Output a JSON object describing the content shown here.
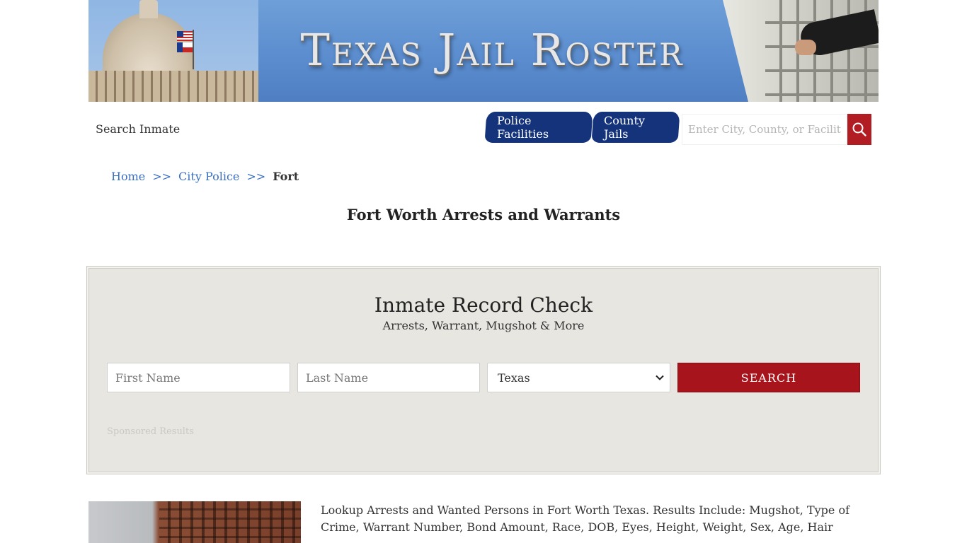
{
  "banner": {
    "title": "Texas Jail Roster"
  },
  "nav": {
    "search_inmate": "Search Inmate",
    "tabs": [
      {
        "label": "Police Facilities"
      },
      {
        "label": "County Jails"
      }
    ],
    "search_placeholder": "Enter City, County, or Facility"
  },
  "breadcrumb": {
    "items": [
      {
        "label": "Home"
      },
      {
        "label": "City Police"
      }
    ],
    "separator": ">>",
    "current": "Fort"
  },
  "page": {
    "title": "Fort Worth Arrests and Warrants"
  },
  "record_check": {
    "title": "Inmate Record Check",
    "subtitle": "Arrests, Warrant, Mugshot & More",
    "first_name_placeholder": "First Name",
    "last_name_placeholder": "Last Name",
    "state_selected": "Texas",
    "search_label": "SEARCH",
    "sponsored": "Sponsored Results"
  },
  "content": {
    "lookup_text": "Lookup Arrests and Wanted Persons in Fort Worth Texas. Results Include: Mugshot, Type of Crime, Warrant Number, Bond Amount, Race, DOB, Eyes, Height, Weight, Sex, Age, Hair"
  },
  "colors": {
    "tab_blue": "#14337a",
    "accent_red": "#a8141b",
    "link_blue": "#3a6fc2",
    "panel_bg": "#e8e6e1"
  }
}
